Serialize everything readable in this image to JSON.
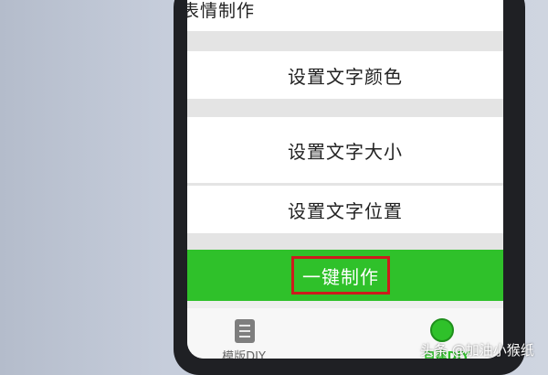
{
  "header": {
    "title": "表情制作"
  },
  "options": [
    {
      "label": "设置文字颜色"
    },
    {
      "label": "设置文字大小"
    },
    {
      "label": "设置文字位置"
    }
  ],
  "action": {
    "label": "一键制作"
  },
  "tabs": [
    {
      "label": "模版DIY",
      "icon": "document-icon"
    },
    {
      "label": "自建DIY",
      "icon": "circle-icon",
      "active": true
    }
  ],
  "watermark": "头条 @加油小猴纸",
  "colors": {
    "accent": "#2fc12a",
    "highlight_border": "#cc1c1c"
  }
}
